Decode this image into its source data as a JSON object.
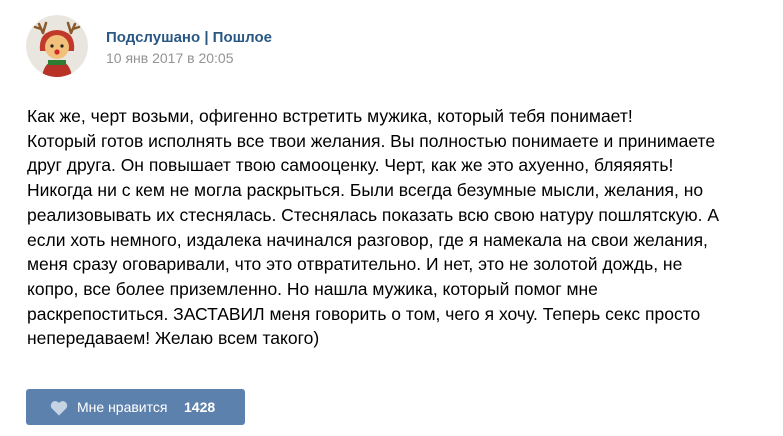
{
  "post": {
    "author": "Подслушано | Пошлое",
    "date": "10 янв 2017 в 20:05",
    "avatar_icon": "reindeer-girl-avatar",
    "text_lines": [
      "Как же, черт возьми, офигенно встретить мужика, который тебя понимает!",
      "Который готов исполнять все твои желания. Вы полностью понимаете и принимаете",
      "друг друга. Он повышает твою самооценку. Черт, как же это ахуенно, бляяяять!",
      "Никогда ни с кем не могла раскрыться. Были всегда безумные мысли, желания, но",
      "реализовывать их стеснялась. Стеснялась показать всю свою натуру пошлятскую. А",
      "если хоть немного, издалека начинался разговор, где я намекала на свои желания,",
      "меня сразу оговаривали, что это отвратительно. И нет, это не золотой дождь, не",
      "копро, все более приземленно. Но нашла мужика, который помог мне",
      "раскрепоститься. ЗАСТАВИЛ меня говорить о том, чего я хочу. Теперь секс просто",
      "непередаваем! Желаю всем такого)"
    ]
  },
  "like": {
    "label": "Мне нравится",
    "count": "1428",
    "icon": "heart-icon"
  },
  "colors": {
    "author_link": "#2a5885",
    "date": "#939393",
    "like_button_bg": "#5d81ad"
  }
}
